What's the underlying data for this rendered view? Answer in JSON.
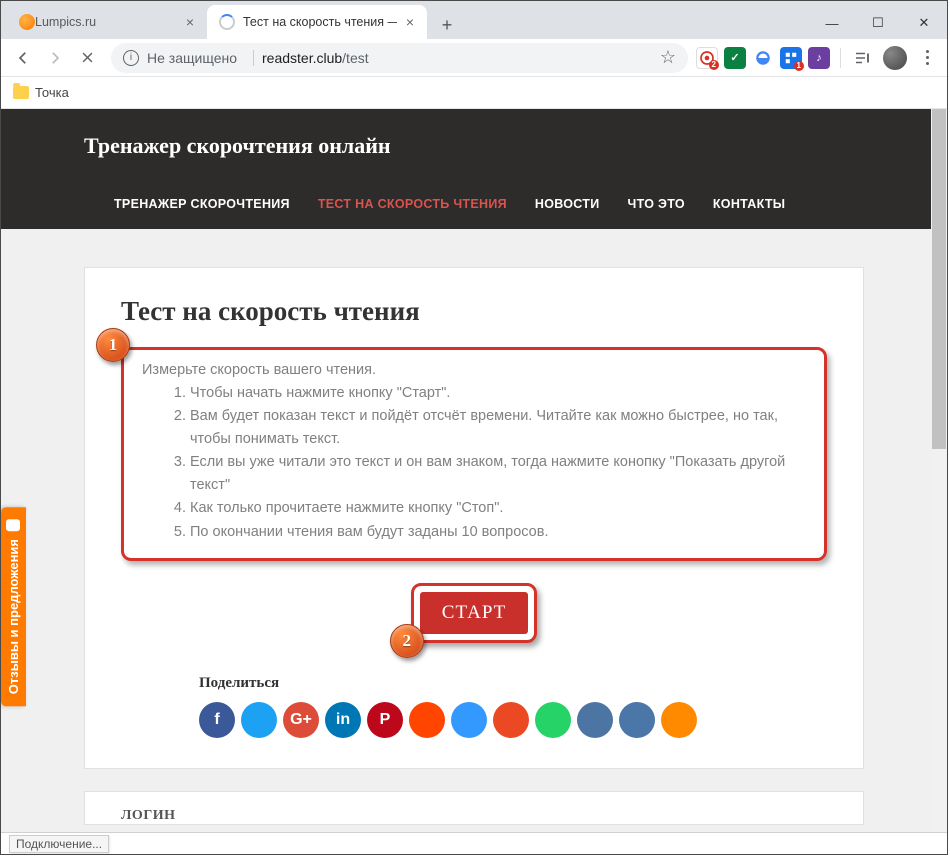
{
  "tabs": [
    {
      "title": "Lumpics.ru"
    },
    {
      "title": "Тест на скорость чтения — Тре"
    }
  ],
  "omnibox": {
    "security": "Не защищено",
    "domain": "readster.club",
    "path": "/test"
  },
  "ext_badges": {
    "red1": "2",
    "blue1": "1"
  },
  "bookmarks": [
    {
      "label": "Точка"
    }
  ],
  "site": {
    "title": "Тренажер скорочтения онлайн",
    "nav": [
      "ТРЕНАЖЕР СКОРОЧТЕНИЯ",
      "ТЕСТ НА СКОРОСТЬ ЧТЕНИЯ",
      "НОВОСТИ",
      "ЧТО ЭТО",
      "КОНТАКТЫ"
    ]
  },
  "article": {
    "title": "Тест на скорость чтения",
    "intro": "Измерьте скорость вашего чтения.",
    "steps": [
      "Чтобы начать нажмите кнопку \"Старт\".",
      "Вам будет показан текст и пойдёт отсчёт времени. Читайте как можно быстрее, но так, чтобы понимать текст.",
      "Если вы уже читали это текст и он вам знаком, тогда нажмите конопку \"Показать другой текст\"",
      "Как только прочитаете нажмите кнопку \"Стоп\".",
      "По окончании чтения вам будут заданы 10 вопросов."
    ],
    "start_label": "СТАРТ",
    "share_label": "Поделиться"
  },
  "markers": {
    "one": "1",
    "two": "2"
  },
  "login": {
    "title": "ЛОГИН"
  },
  "feedback": {
    "label": "Отзывы и предложения"
  },
  "status": {
    "text": "Подключение..."
  },
  "share_colors": [
    "#3b5998",
    "#1da1f2",
    "#dd4b39",
    "#0077b5",
    "#bd081c",
    "#ff4500",
    "#3399ff",
    "#eb4924",
    "#25d366",
    "#4c75a3",
    "#4a76a8",
    "#ff8a00"
  ],
  "share_glyphs": [
    "f",
    "",
    "G+",
    "in",
    "P",
    "",
    "",
    "",
    "",
    "",
    "",
    ""
  ]
}
